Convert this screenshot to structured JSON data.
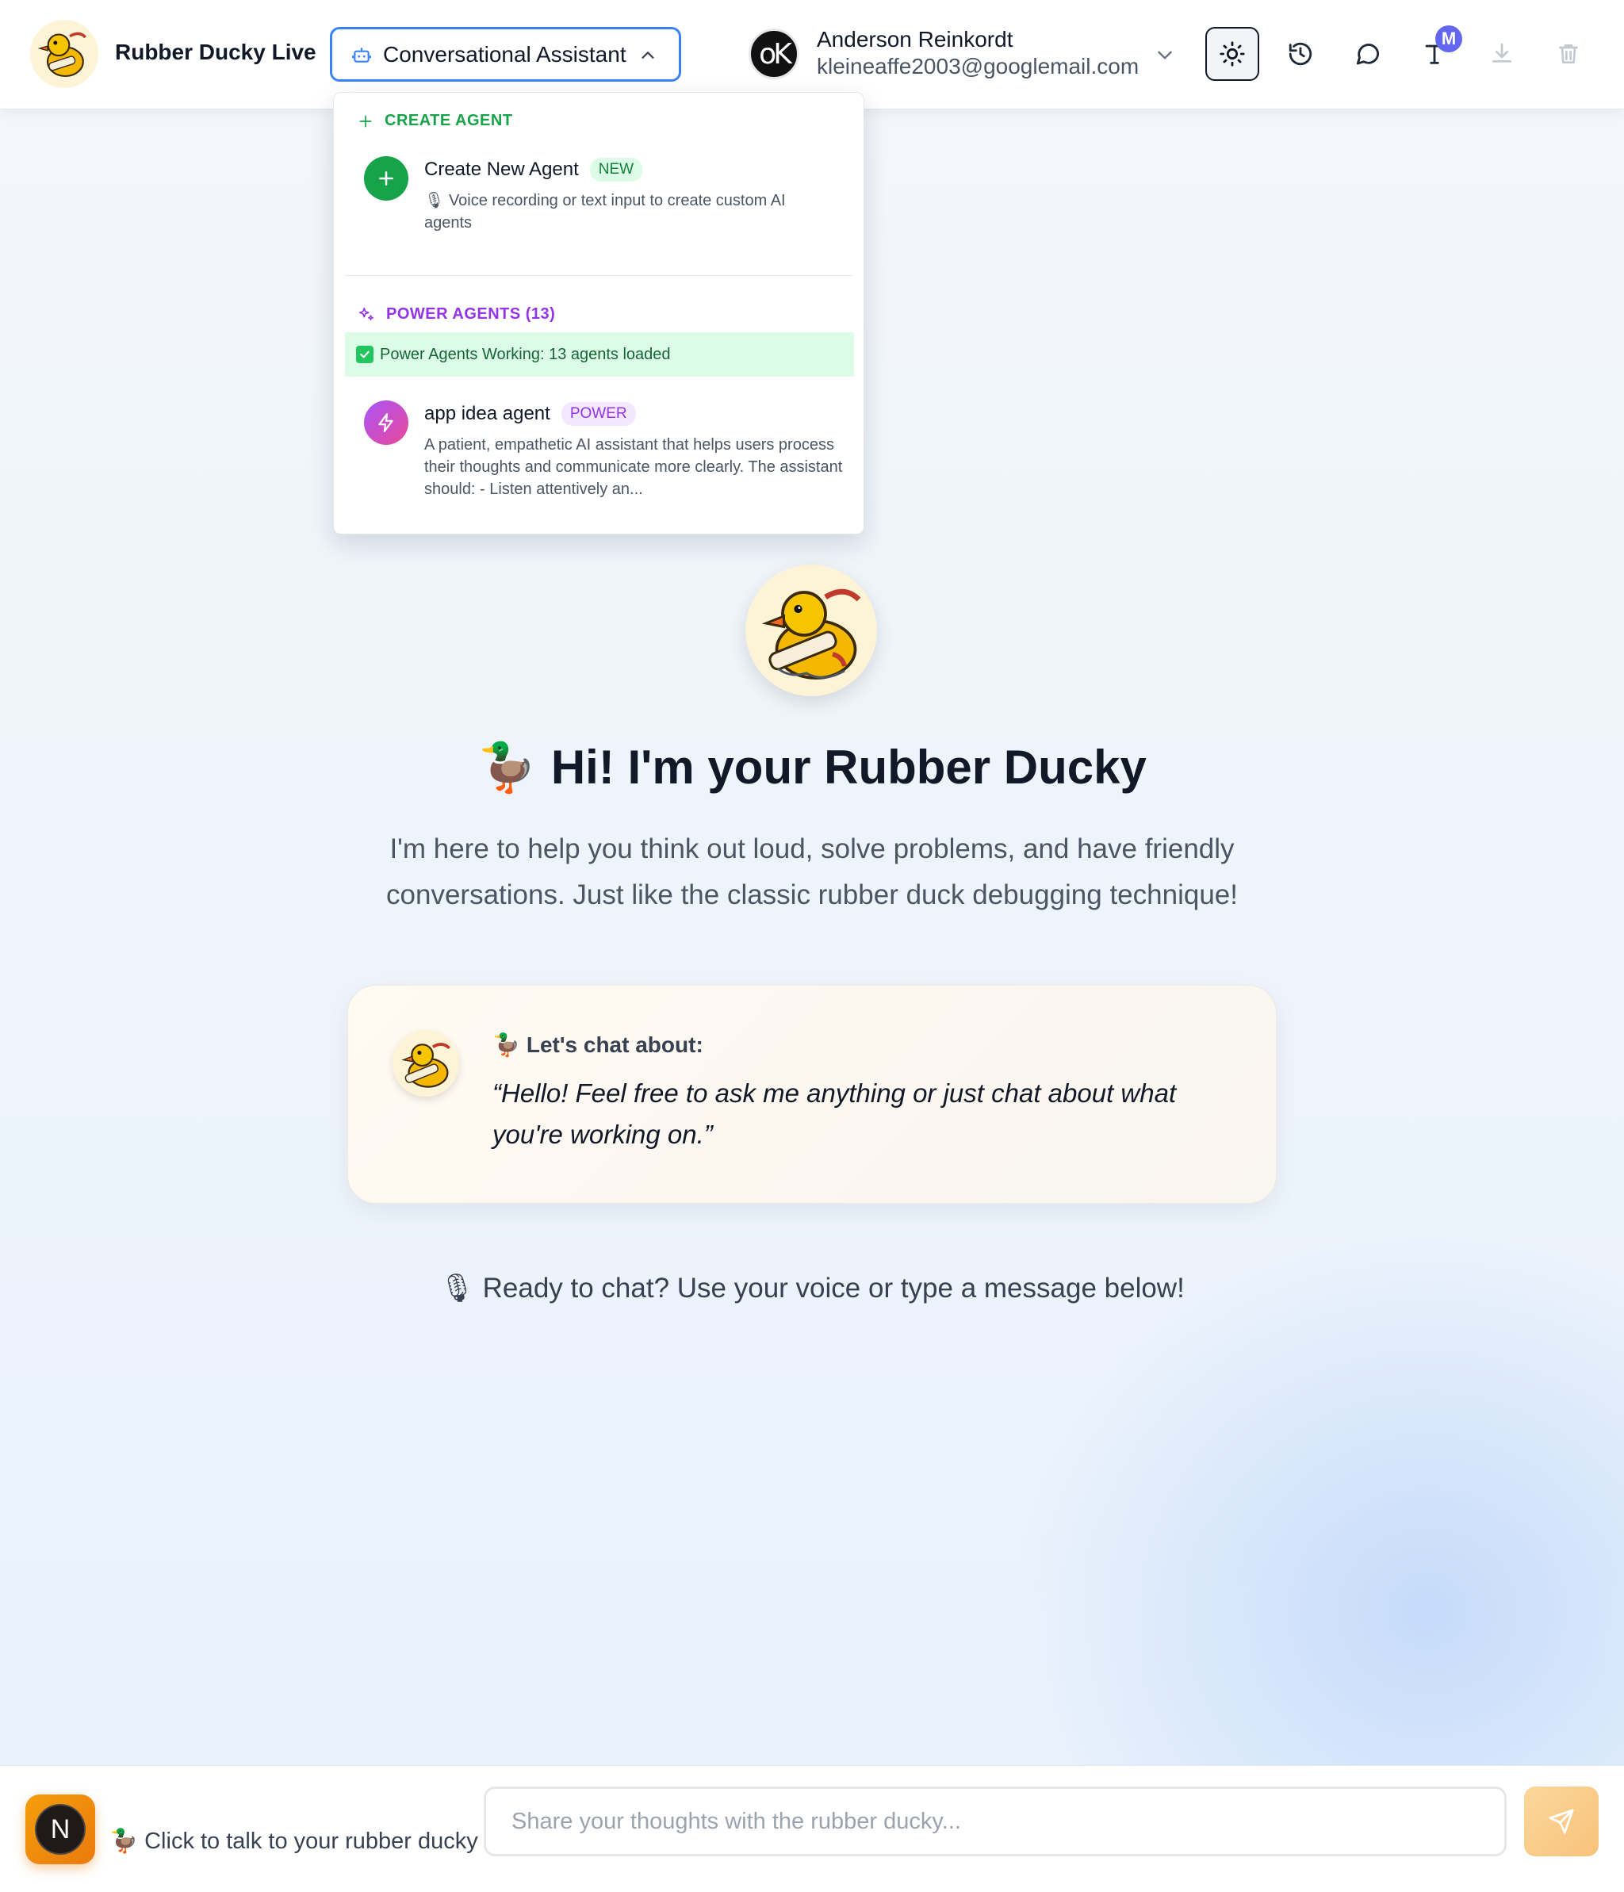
{
  "header": {
    "app_title": "Rubber Ducky Live",
    "agent_selector": {
      "label": "Conversational Assistant",
      "expanded": true
    },
    "user": {
      "avatar_text": "oK",
      "name": "Anderson Reinkordt",
      "email": "kleineaffe2003@googlemail.com"
    },
    "actions": [
      {
        "name": "theme-toggle",
        "icon": "sun-icon",
        "active": true
      },
      {
        "name": "history",
        "icon": "history-icon"
      },
      {
        "name": "chat",
        "icon": "chat-bubble-icon"
      },
      {
        "name": "font",
        "icon": "text-icon",
        "badge": "M"
      },
      {
        "name": "download",
        "icon": "download-icon",
        "disabled": true
      },
      {
        "name": "delete",
        "icon": "trash-icon",
        "disabled": true
      }
    ]
  },
  "dropdown": {
    "create_section_title": "CREATE AGENT",
    "create_item": {
      "title": "Create New Agent",
      "badge": "NEW",
      "description": "🎙 Voice recording or text input to create custom AI agents"
    },
    "power_section_title": "POWER AGENTS (13)",
    "status": "Power Agents Working: 13 agents loaded",
    "power_items": [
      {
        "title": "app idea agent",
        "badge": "POWER",
        "description": "A patient, empathetic AI assistant that helps users process their thoughts and communicate more clearly. The assistant should: - Listen attentively an..."
      }
    ]
  },
  "main": {
    "hero_emoji": "🦆",
    "hero_title": "Hi! I'm your Rubber Ducky",
    "hero_subtitle": "I'm here to help you think out loud, solve problems, and have friendly conversations. Just like the classic rubber duck debugging technique!",
    "card": {
      "emoji": "🦆",
      "heading": "Let's chat about:",
      "quote": "“Hello! Feel free to ask me anything or just chat about what you're working on.”"
    },
    "ready_emoji": "🎙",
    "ready_text": "Ready to chat? Use your voice or type a message below!"
  },
  "bottom": {
    "mic_letter": "N",
    "talk_emoji": "🦆",
    "talk_label": "Click to talk to your rubber ducky",
    "input_placeholder": "Share your thoughts with the rubber ducky...",
    "input_value": ""
  },
  "colors": {
    "accent_blue": "#3b82f6",
    "create_green": "#16a34a",
    "power_purple": "#9333ea",
    "mic_orange": "#f59e0b",
    "send_peach": "#f7c27b"
  }
}
